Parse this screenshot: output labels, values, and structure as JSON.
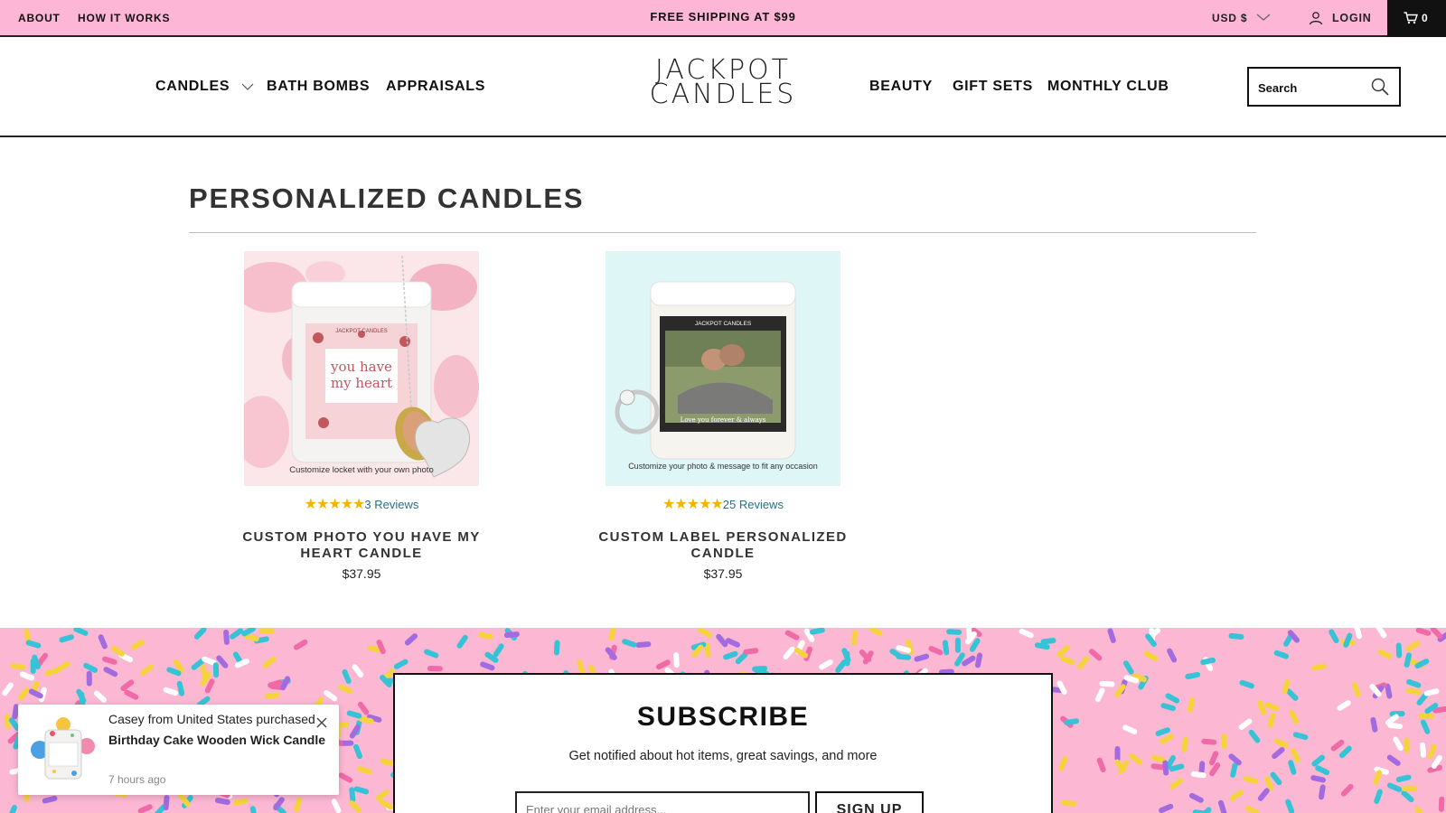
{
  "topbar": {
    "about": "ABOUT",
    "how_it_works": "HOW IT WORKS",
    "shipping": "FREE SHIPPING AT $99",
    "currency": "USD $",
    "login": "LOGIN",
    "cart_count": "0"
  },
  "nav": {
    "candles": "CANDLES",
    "bath_bombs": "BATH BOMBS",
    "appraisals": "APPRAISALS",
    "beauty": "BEAUTY",
    "gift_sets": "GIFT SETS",
    "monthly_club": "MONTHLY CLUB"
  },
  "logo": {
    "line1": "JACKPOT",
    "line2": "CANDLES"
  },
  "search": {
    "placeholder": "Search"
  },
  "collection": {
    "title": "PERSONALIZED CANDLES",
    "products": [
      {
        "name": "CUSTOM PHOTO YOU HAVE MY HEART CANDLE",
        "price": "$37.95",
        "reviews": "3 Reviews",
        "rating": 5,
        "image_caption": "Customize locket with your own photo",
        "label_brand": "JACKPOT CANDLES",
        "label_text": "you have my heart"
      },
      {
        "name": "CUSTOM LABEL PERSONALIZED CANDLE",
        "price": "$37.95",
        "reviews": "25 Reviews",
        "rating": 5,
        "image_caption": "Customize your photo & message to fit any occasion",
        "label_brand": "JACKPOT CANDLES",
        "label_text": "Love you forever & always"
      }
    ]
  },
  "subscribe": {
    "title": "SUBSCRIBE",
    "description": "Get notified about hot items, great savings, and more",
    "email_placeholder": "Enter your email address...",
    "button": "SIGN UP"
  },
  "toast": {
    "buyer": "Casey from United States purchased",
    "product": "Birthday Cake Wooden Wick Candle",
    "time": "7 hours ago"
  },
  "colors": {
    "topbar_pink": "#fdb6d6",
    "star_gold": "#f5b400",
    "review_link": "#2a6f84"
  }
}
